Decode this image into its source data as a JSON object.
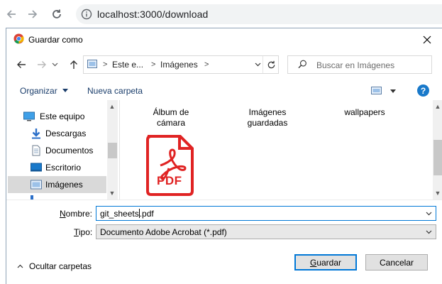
{
  "browser": {
    "url": "localhost:3000/download"
  },
  "dialog": {
    "title": "Guardar como",
    "breadcrumb": [
      "Este e...",
      "Imágenes"
    ],
    "search_placeholder": "Buscar en Imágenes",
    "toolbar": {
      "organize": "Organizar",
      "new_folder": "Nueva carpeta"
    },
    "nav_items": [
      {
        "label": "Este equipo",
        "icon": "computer-icon"
      },
      {
        "label": "Descargas",
        "icon": "downloads-icon"
      },
      {
        "label": "Documentos",
        "icon": "documents-icon"
      },
      {
        "label": "Escritorio",
        "icon": "desktop-icon"
      },
      {
        "label": "Imágenes",
        "icon": "pictures-icon",
        "selected": true
      }
    ],
    "files": [
      {
        "line1": "Álbum de",
        "line2": "cámara"
      },
      {
        "line1": "Imágenes",
        "line2": "guardadas"
      },
      {
        "line1": "wallpapers",
        "line2": ""
      }
    ],
    "pdf_icon_text": "PDF",
    "filename": {
      "label_underlined": "N",
      "label_rest": "ombre:",
      "value_before_caret": "git_sheets",
      "value_after_caret": ".pdf"
    },
    "filetype": {
      "label_underlined": "T",
      "label_rest": "ipo:",
      "value": "Documento Adobe Acrobat (*.pdf)"
    },
    "hide_folders": "Ocultar carpetas",
    "save_underlined": "G",
    "save_rest": "uardar",
    "cancel": "Cancelar"
  },
  "colors": {
    "accent": "#0078d7",
    "pdf_red": "#e02323",
    "help_blue": "#1979ca"
  }
}
